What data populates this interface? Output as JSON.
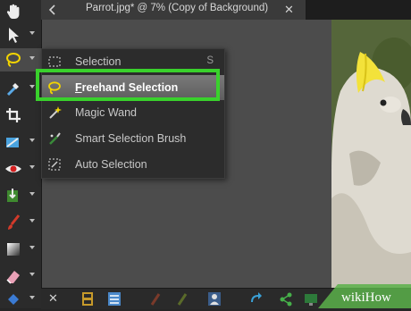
{
  "tab": {
    "title": "Parrot.jpg* @    7% (Copy of Background)",
    "close": "✕"
  },
  "bottombar": {
    "close": "✕"
  },
  "flyout": {
    "items": [
      {
        "label": "Selection",
        "shortcut": "S",
        "icon": "rectangle-marquee-icon"
      },
      {
        "label": "Freehand Selection",
        "mnemonic": "F",
        "rest": "reehand Selection",
        "icon": "lasso-icon"
      },
      {
        "label": "Magic Wand",
        "icon": "magic-wand-icon"
      },
      {
        "label": "Smart Selection Brush",
        "icon": "smart-brush-icon"
      },
      {
        "label": "Auto Selection",
        "icon": "auto-selection-icon"
      }
    ]
  },
  "watermark": {
    "text": "wikiHow"
  },
  "colors": {
    "highlight": "#39d12c",
    "selected_item": "#6a6a6a"
  }
}
